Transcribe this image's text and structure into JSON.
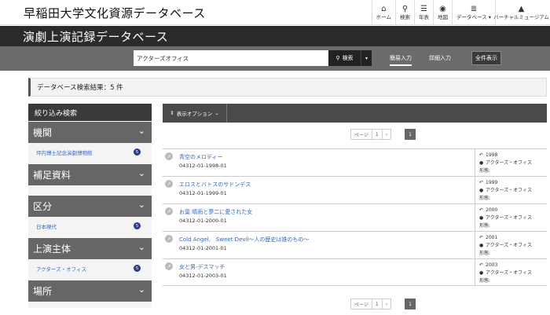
{
  "header": {
    "site_title": "早稲田大学文化資源データベース",
    "nav": [
      {
        "icon": "home-icon",
        "glyph": "⌂",
        "label": "ホーム"
      },
      {
        "icon": "search-icon",
        "glyph": "🔍",
        "label": "検索"
      },
      {
        "icon": "timeline-icon",
        "glyph": "☰",
        "label": "年表"
      },
      {
        "icon": "map-pin-icon",
        "glyph": "⚲",
        "label": "地図"
      },
      {
        "icon": "database-icon",
        "glyph": "≣",
        "label": "データベース ▾"
      },
      {
        "icon": "museum-icon",
        "glyph": "🏛",
        "label": "バーチャルミュージアム"
      }
    ]
  },
  "db": {
    "title": "演劇上演記録データベース"
  },
  "search": {
    "value": "アクターズオフィス",
    "button_label": "検索",
    "simple_label": "簡易入力",
    "detail_label": "詳細入力",
    "all_label": "全件表示"
  },
  "result_count": "データベース検索結果：5 件",
  "sidebar": {
    "heading": "絞り込み検索",
    "facets": [
      {
        "label": "機関",
        "item": "坪内博士記念演劇博物館",
        "count": "5"
      },
      {
        "label": "補足資料",
        "item": "",
        "count": ""
      },
      {
        "label": "区分",
        "item": "日本現代",
        "count": "5"
      },
      {
        "label": "上演主体",
        "item": "アクターズ・オフィス",
        "count": "5"
      },
      {
        "label": "場所",
        "item": "",
        "count": ""
      }
    ]
  },
  "main": {
    "options_label": "表示オプション",
    "pager": {
      "page_label": "ページ",
      "page_value": "1",
      "current": "1"
    },
    "meta_form_label": "形態:",
    "results": [
      {
        "title": "青空のメロディー",
        "code": "04312-01-1998-01",
        "year": "1998",
        "troupe": "アクターズ・オフィス"
      },
      {
        "title": "エロスとバトスのサドンデス",
        "code": "04312-01-1999-01",
        "year": "1999",
        "troupe": "アクターズ・オフィス"
      },
      {
        "title": "お葉 晴雨と夢二に愛された女",
        "code": "04312-01-2000-01",
        "year": "2000",
        "troupe": "アクターズ・オフィス"
      },
      {
        "title": "Cold Angel,　Sweet Devil〜人の歴史は誰のもの〜",
        "code": "04312-01-2001-01",
        "year": "2001",
        "troupe": "アクターズ・オフィス"
      },
      {
        "title": "女と男-デスマッチ",
        "code": "04312-01-2003-01",
        "year": "2003",
        "troupe": "アクターズ・オフィス"
      }
    ]
  }
}
